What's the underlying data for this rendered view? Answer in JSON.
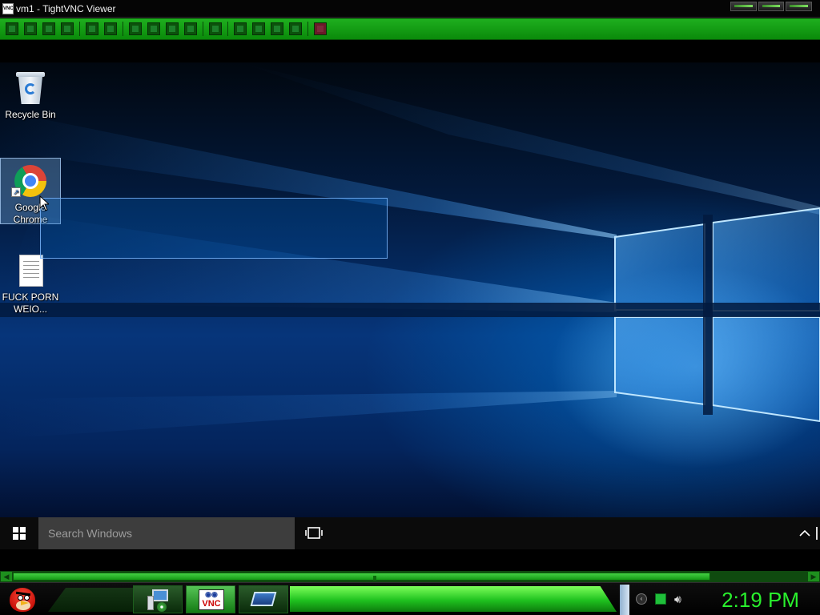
{
  "vnc_window": {
    "title": "vm1 - TightVNC Viewer",
    "app_icon_text": "VNC",
    "accent_color": "#16a016",
    "toolbar": {
      "buttons": [
        "new-connection",
        "save-session",
        "options",
        "connection-info",
        "pause",
        "refresh",
        "ctrl-alt-del",
        "send-ctrl",
        "send-alt",
        "send-win",
        "transfer-files",
        "zoom-in",
        "zoom-out",
        "zoom-100",
        "zoom-fit",
        "fullscreen"
      ]
    }
  },
  "desktop": {
    "icons": [
      {
        "label": "Recycle Bin",
        "icon": "recycle-bin-icon"
      },
      {
        "label": "Google Chrome",
        "icon": "chrome-icon",
        "selected": true
      },
      {
        "label": "FUCK PORNWEIO...",
        "icon": "text-document-icon"
      }
    ],
    "wallpaper": "windows-10-hero-blue"
  },
  "remote_taskbar": {
    "search_placeholder": "Search Windows",
    "start_icon": "windows-logo-icon",
    "task_view_icon": "task-view-icon",
    "tray_chevron_icon": "chevron-up-icon"
  },
  "host_taskbar": {
    "start_icon": "angry-bird-start-icon",
    "pinned": [
      {
        "name": "network-computer-icon"
      },
      {
        "name": "tightvnc-icon",
        "badge_top": "◉◉",
        "badge_text": "VNC",
        "active": true
      },
      {
        "name": "remote-desktop-icon"
      }
    ],
    "tray": [
      "show-hidden-icon",
      "network-icon",
      "volume-icon"
    ],
    "clock": "2:19 PM",
    "clock_color": "#29f02d"
  }
}
